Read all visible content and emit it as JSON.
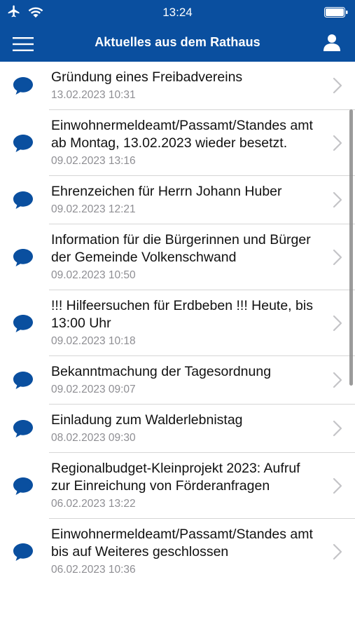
{
  "status_bar": {
    "time": "13:24",
    "icons": [
      "airplane-icon",
      "wifi-icon",
      "battery-icon"
    ]
  },
  "nav": {
    "title": "Aktuelles aus dem Rathaus",
    "left_icon": "hamburger-menu-icon",
    "right_icon": "user-icon"
  },
  "colors": {
    "brand_blue": "#0a4f9f",
    "text": "#111111",
    "date_gray": "#8e8e93",
    "separator": "#d6d6d6",
    "chevron": "#c4c4c7"
  },
  "news": [
    {
      "title": "Gründung eines Freibadvereins",
      "date": "13.02.2023 10:31"
    },
    {
      "title": "Einwohnermeldeamt/Passamt/Standes amt ab Montag, 13.02.2023 wieder besetzt.",
      "date": "09.02.2023 13:16"
    },
    {
      "title": "Ehrenzeichen für Herrn Johann Huber",
      "date": "09.02.2023 12:21"
    },
    {
      "title": "Information für die Bürgerinnen und Bürger der Gemeinde Volkenschwand",
      "date": "09.02.2023 10:50"
    },
    {
      "title": "!!! Hilfeersuchen für Erdbeben !!! Heute, bis 13:00 Uhr",
      "date": "09.02.2023 10:18"
    },
    {
      "title": "Bekanntmachung der Tagesordnung",
      "date": "09.02.2023 09:07"
    },
    {
      "title": "Einladung zum Walderlebnistag",
      "date": "08.02.2023 09:30"
    },
    {
      "title": "Regionalbudget-Kleinprojekt 2023: Aufruf zur Einreichung von Förderanfragen",
      "date": "06.02.2023 13:22"
    },
    {
      "title": "Einwohnermeldeamt/Passamt/Standes amt bis auf Weiteres geschlossen",
      "date": "06.02.2023 10:36"
    }
  ]
}
